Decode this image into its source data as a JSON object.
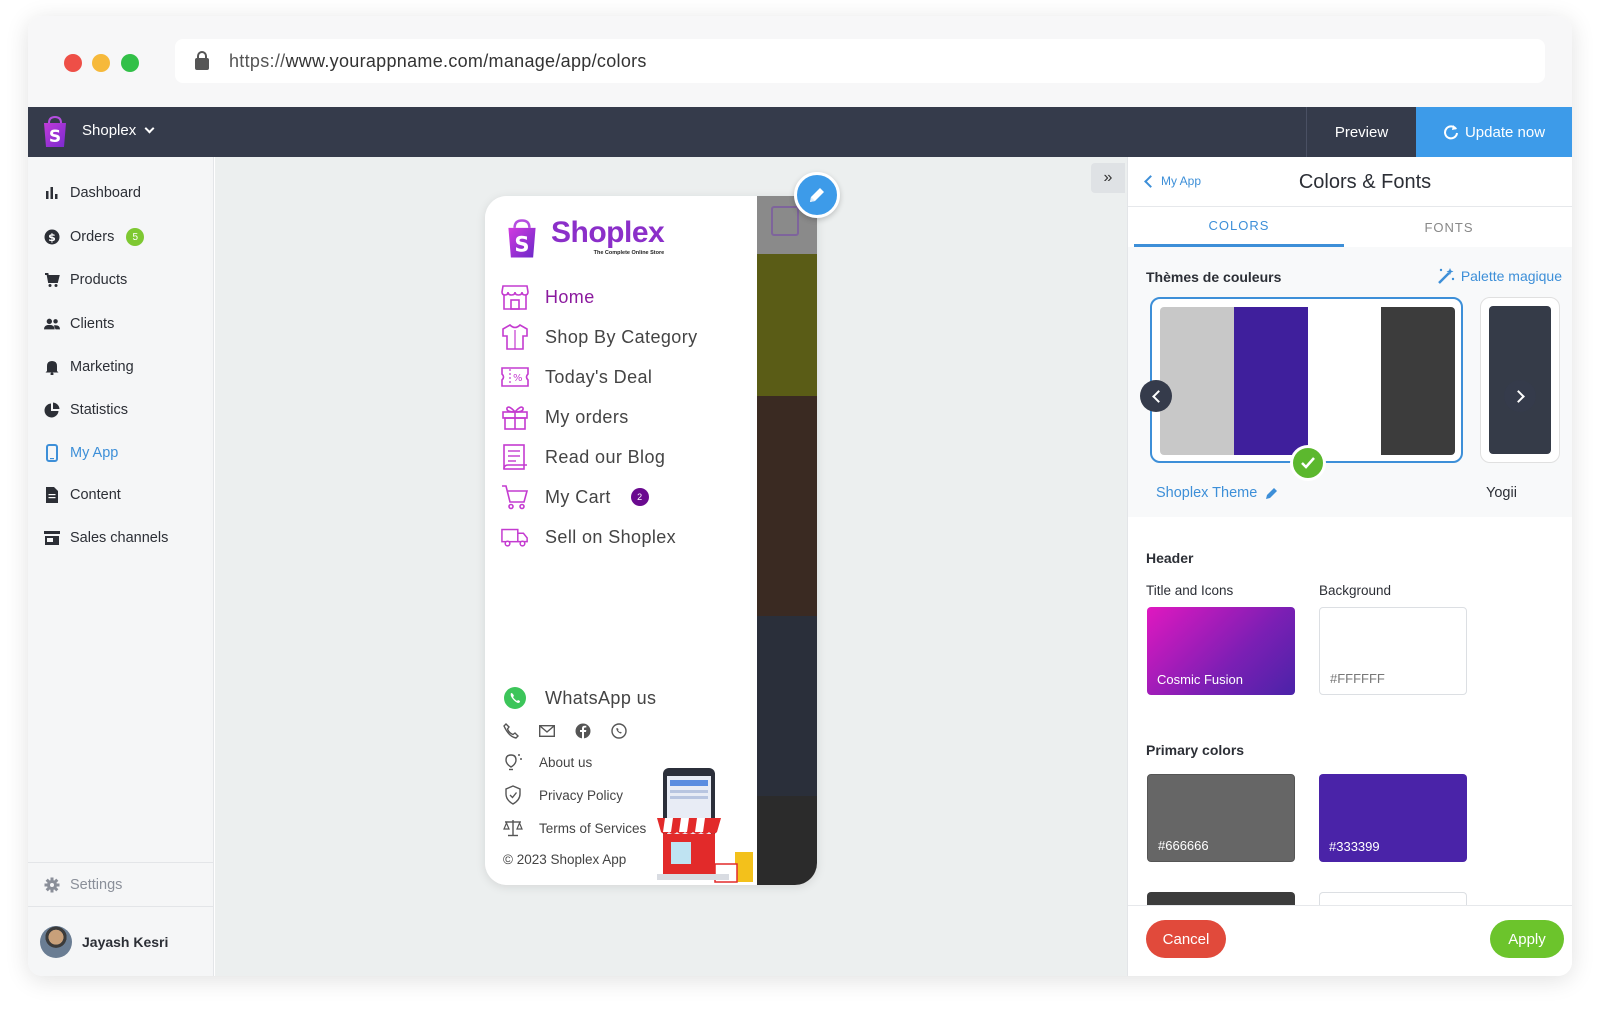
{
  "browser": {
    "url_proto": "https://",
    "url_rest": "www.yourappname.com/manage/app/colors"
  },
  "topbar": {
    "store_name": "Shoplex",
    "preview_label": "Preview",
    "update_label": "Update now"
  },
  "sidebar": {
    "items": [
      {
        "label": "Dashboard",
        "icon": "bar-chart-icon"
      },
      {
        "label": "Orders",
        "icon": "dollar-icon",
        "badge": "5"
      },
      {
        "label": "Products",
        "icon": "cart-icon"
      },
      {
        "label": "Clients",
        "icon": "users-icon"
      },
      {
        "label": "Marketing",
        "icon": "bell-icon"
      },
      {
        "label": "Statistics",
        "icon": "pie-chart-icon"
      },
      {
        "label": "My App",
        "icon": "phone-icon",
        "active": true
      },
      {
        "label": "Content",
        "icon": "document-icon"
      },
      {
        "label": "Sales channels",
        "icon": "store-icon"
      }
    ],
    "settings_label": "Settings",
    "user_name": "Jayash Kesri"
  },
  "phone": {
    "brand": "Shoplex",
    "tagline": "The Complete Online Store",
    "menu": [
      {
        "label": "Home",
        "icon": "store-front-icon"
      },
      {
        "label": "Shop By Category",
        "icon": "shirt-icon"
      },
      {
        "label": "Today's Deal",
        "icon": "ticket-icon"
      },
      {
        "label": "My orders",
        "icon": "gift-icon"
      },
      {
        "label": "Read our Blog",
        "icon": "blog-icon"
      },
      {
        "label": "My Cart",
        "icon": "cart-icon",
        "badge": "2"
      },
      {
        "label": "Sell on Shoplex",
        "icon": "truck-icon"
      }
    ],
    "whatsapp_label": "WhatsApp us",
    "links": [
      {
        "label": "About us",
        "icon": "bulb-icon"
      },
      {
        "label": "Privacy Policy",
        "icon": "shield-icon"
      },
      {
        "label": "Terms of Services",
        "icon": "scale-icon"
      }
    ],
    "copyright": "© 2023 Shoplex App"
  },
  "panel": {
    "back_label": "My App",
    "title": "Colors & Fonts",
    "tabs": [
      {
        "label": "COLORS",
        "active": true
      },
      {
        "label": "FONTS",
        "active": false
      }
    ],
    "themes_title": "Thèmes de couleurs",
    "magic_label": "Palette magique",
    "theme_swatches": [
      "#c8c8c8",
      "#3f1f9c",
      "#ffffff",
      "#3c3c3c"
    ],
    "theme_name": "Shoplex Theme",
    "theme_next_name": "Yogii",
    "header_title": "Header",
    "title_icons_label": "Title and Icons",
    "background_label": "Background",
    "title_icons_value": "Cosmic Fusion",
    "background_value": "#FFFFFF",
    "primary_title": "Primary colors",
    "primary_1": "#666666",
    "primary_2": "#333399",
    "cancel_label": "Cancel",
    "apply_label": "Apply"
  }
}
